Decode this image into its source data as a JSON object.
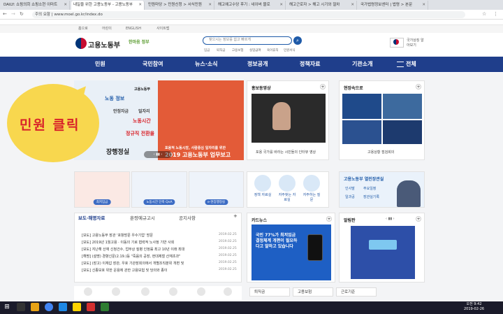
{
  "browser": {
    "tabs": [
      {
        "label": "DAILY: 쇼핑의회 쇼핑소현 이마트"
      },
      {
        "label": "내일을 위한 고용노동부 - 고용노동부"
      },
      {
        "label": "민원마당 > 민원신청 > 서식민원"
      },
      {
        "label": "해고예고수당 후기 : 네이버 블로"
      },
      {
        "label": "해고근로자 > 해고 시기와 절차"
      },
      {
        "label": "국가법령정보센터 | 법령 > 본문"
      }
    ],
    "url": "주의 요함 | www.moel.go.kr/index.do"
  },
  "utility": [
    "홈으로",
    "어린이",
    "ENGLISH",
    "사이트맵"
  ],
  "header": {
    "logo": "고용노동부",
    "slogan": "한마음 정부",
    "search_placeholder": "찾으시는 정보를 쉽고 빠르게",
    "quick_links": [
      "임금",
      "퇴직금",
      "고용보험",
      "실업급여",
      "육아휴직",
      "민원서식"
    ],
    "right_label": "국가상징 알아보기"
  },
  "nav": [
    "민원",
    "국민참여",
    "뉴스·소식",
    "정보공개",
    "정책자료",
    "기관소개",
    "전체"
  ],
  "banner": {
    "line1": "노동 정보",
    "line2": "고용노동부",
    "left_items": [
      "안정자금",
      "일자리",
      "노동시간",
      "정규직 전환을"
    ],
    "left_footer": "장행정실",
    "right_title": "2019 고용노동부 업무보고",
    "right_sub": "포용적 노동시장, 사람중심 일자리를 위한"
  },
  "annotation": "민원 클릭",
  "cards": {
    "video": {
      "title": "홍보동영상",
      "caption": "포용 국가를 바라는 시민들의 인터뷰 영상"
    },
    "field": {
      "title": "현장속으로",
      "caption": "고용상황 점검회의"
    },
    "minister": {
      "title": "고용노동부 열린장관실",
      "items": [
        "인사말",
        "주요일정",
        "일과공",
        "장관실기록"
      ]
    }
  },
  "services": {
    "min_wage": "최저임금",
    "hours": "노동시간 단축 QnA",
    "e_admin": "e-현장행정실",
    "circles": [
      "정책 자료실",
      "자주찾는 자료실",
      "자주하는 질문"
    ]
  },
  "news": {
    "tabs": [
      "보도·해명자료",
      "훈령예규고시",
      "공지사항"
    ],
    "rows": [
      {
        "text": "[보도] 고용노동부 장관 '포항방문 우수기업' 방문",
        "date": "2019.02.25"
      },
      {
        "text": "[보도] 2019년 1월고용 · 이동의 기로 협력적 노사정 기반 사회",
        "date": "2019.02.25"
      },
      {
        "text": "[보도] 지난해 산재 신청건수, 업무상 질병 인정률 최고 10년 이래 최대",
        "date": "2019.02.25"
      },
      {
        "text": "[해명] (설명) 경향신문(2.19.)등 \"죽음의 공장, 현대제철 산재초과\"",
        "date": "2019.02.25"
      },
      {
        "text": "[보도] (장고) 이재갑 장관, 우호 기관장회의에서 개별조직분위 개편 및",
        "date": "2019.02.25"
      },
      {
        "text": "[보도] 신종보호 위한 운용에 관한 고용보험 및 당의와 종이",
        "date": "2019.02.25"
      }
    ]
  },
  "cardnews": {
    "title": "카드뉴스",
    "headline": "국민 77%가 최저임금 결정체계 개편이 필요하다고 말하고 있습니다"
  },
  "alert": {
    "title": "알림판"
  },
  "pills": [
    "퇴직금",
    "고용보험",
    "근로기준"
  ],
  "taskbar": {
    "time": "오전 9:42",
    "date": "2019-02-26"
  }
}
